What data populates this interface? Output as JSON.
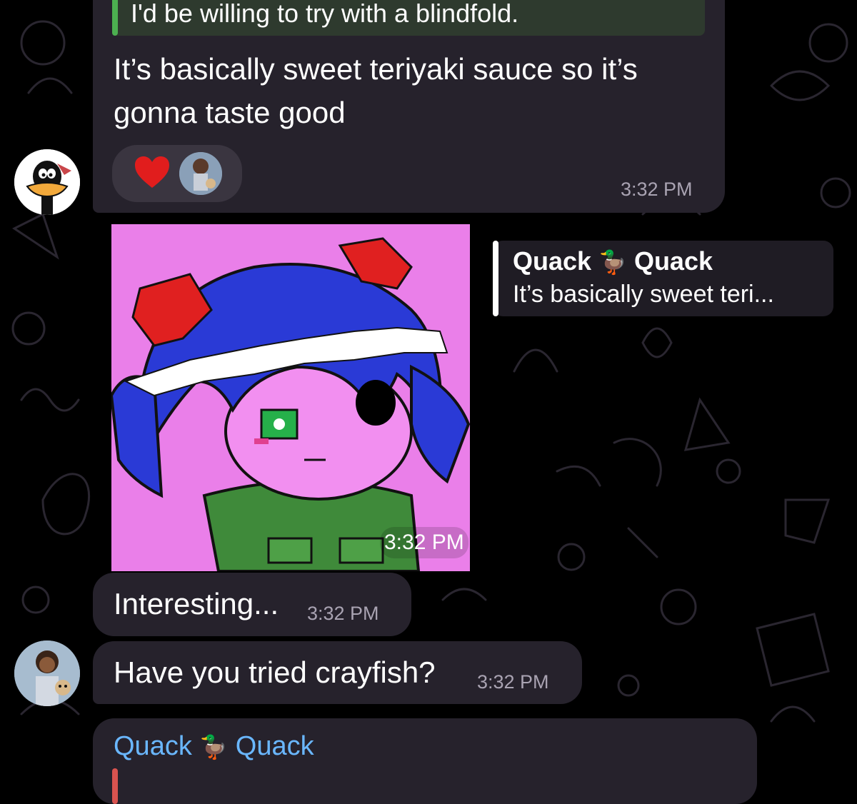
{
  "messages": {
    "teriyaki": {
      "quoted_text": "I'd be willing to try with a blindfold.",
      "body_line1": "It’s basically sweet teriyaki sauce so it’s",
      "body_line2": "gonna taste good",
      "reaction_emoji": "❤️",
      "time": "3:32 PM"
    },
    "image_msg": {
      "time": "3:32 PM",
      "reply": {
        "sender_left": "Quack",
        "sender_emoji": "🦆",
        "sender_right": "Quack",
        "snippet": "It’s basically sweet teri..."
      }
    },
    "interesting": {
      "text": "Interesting...",
      "time": "3:32 PM"
    },
    "crayfish": {
      "text": "Have you tried crayfish?",
      "time": "3:32 PM"
    },
    "partial": {
      "sender_left": "Quack",
      "sender_emoji": "🦆",
      "sender_right": "Quack"
    }
  },
  "colors": {
    "bubble": "#26222c",
    "accent_green": "#4caf50",
    "name_blue": "#6ab7ff",
    "time_gray": "#a9a3b2"
  }
}
